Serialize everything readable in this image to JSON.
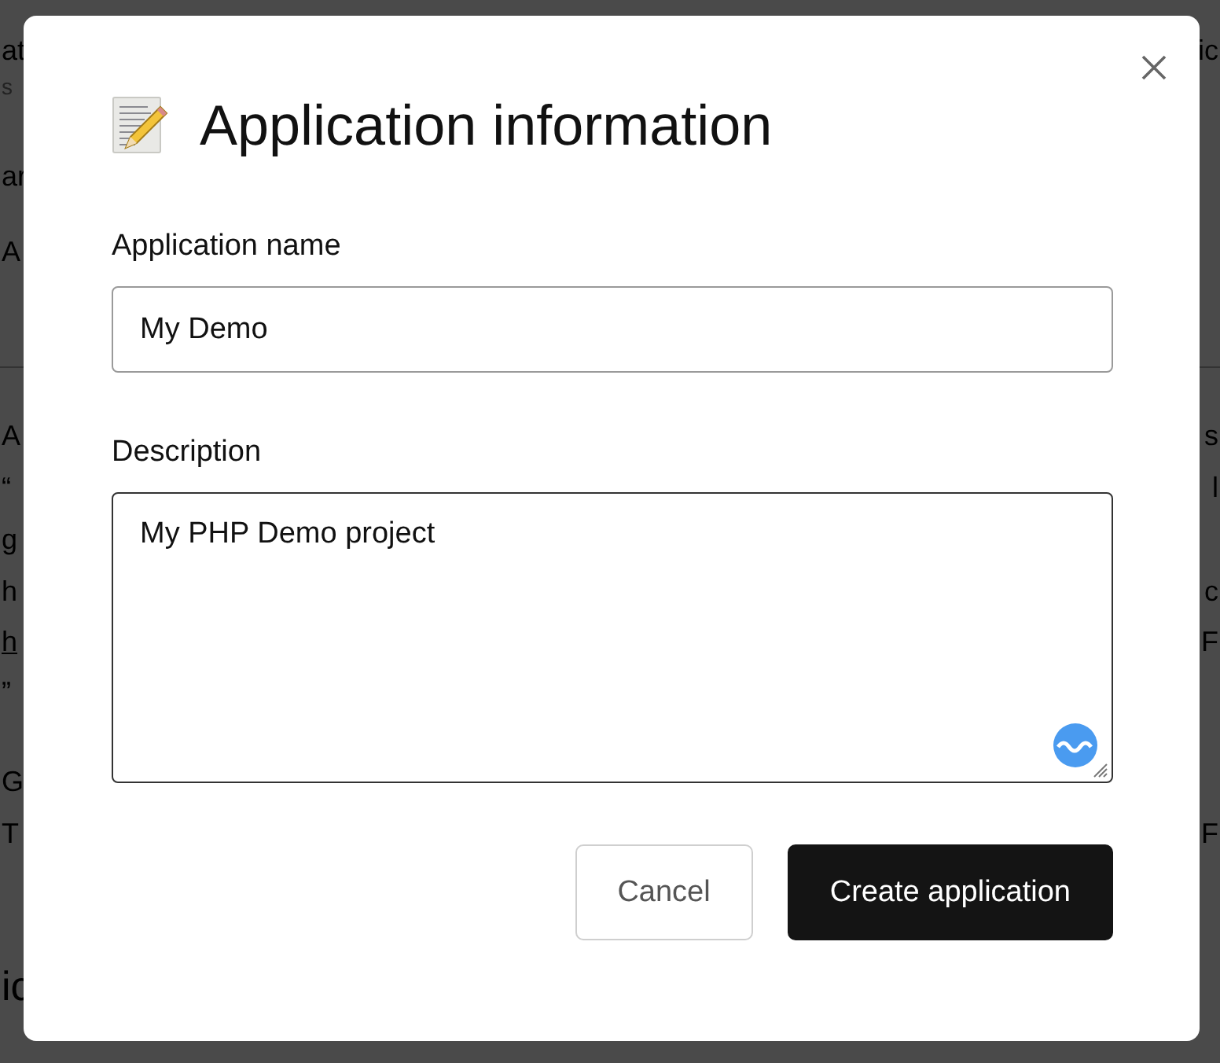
{
  "background_page": {
    "rows": [
      {
        "left": {
          "text": "at",
          "kind": "text"
        },
        "right": {
          "text": "ic",
          "kind": "text"
        }
      },
      {
        "left": {
          "text": "s",
          "kind": "small"
        }
      },
      {
        "left": {
          "text": "ar",
          "kind": "text"
        }
      },
      {
        "left": {
          "text": "A",
          "kind": "text"
        }
      },
      {
        "left": {
          "text": "A",
          "kind": "text"
        },
        "right": {
          "text": "s",
          "kind": "text"
        }
      },
      {
        "left": {
          "text": "“",
          "kind": "text"
        },
        "right": {
          "text": "l",
          "kind": "text"
        }
      },
      {
        "left": {
          "text": "g",
          "kind": "text"
        }
      },
      {
        "left": {
          "text": "h",
          "kind": "text"
        },
        "right": {
          "text": "c",
          "kind": "text"
        }
      },
      {
        "left": {
          "text": "h",
          "kind": "link"
        },
        "right": {
          "text": "F",
          "kind": "text"
        }
      },
      {
        "left": {
          "text": "”",
          "kind": "text"
        }
      },
      {
        "left": {
          "text": "G",
          "kind": "text"
        }
      },
      {
        "left": {
          "text": "T",
          "kind": "text"
        },
        "right": {
          "text": "F",
          "kind": "text"
        }
      },
      {
        "left": {
          "text": "ic",
          "kind": "heading"
        }
      }
    ]
  },
  "dialog": {
    "title": "Application information",
    "fields": [
      {
        "kind": "input",
        "label": "Application name",
        "value": "My Demo",
        "focused": false
      },
      {
        "kind": "textarea",
        "label": "Description",
        "value": "My PHP Demo project",
        "focused": true
      }
    ],
    "buttons": [
      {
        "label": "Cancel",
        "kind": "secondary"
      },
      {
        "label": "Create application",
        "kind": "primary"
      }
    ]
  }
}
